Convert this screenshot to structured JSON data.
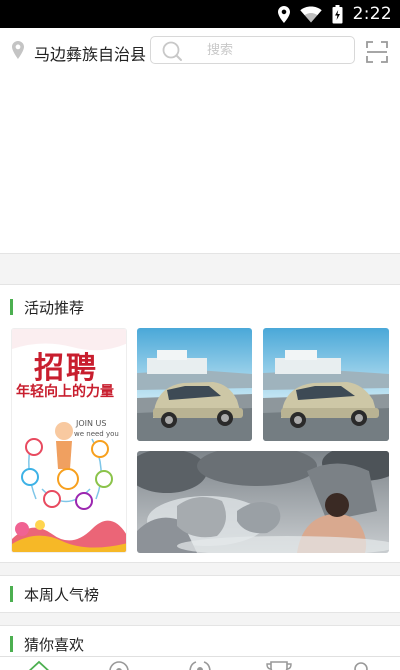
{
  "status_bar": {
    "time": "2:22",
    "icons": [
      "location-icon",
      "wifi-icon",
      "battery-icon"
    ]
  },
  "header": {
    "location": "马边彝族自治县",
    "search_placeholder": "搜索",
    "icons": [
      "location-pin-icon",
      "search-icon",
      "scan-icon"
    ]
  },
  "sections": {
    "activity": "活动推荐",
    "weekly_popular": "本周人气榜",
    "guess_you_like": "猜你喜欢"
  },
  "activity_tiles": {
    "recruit": {
      "headline": "招聘",
      "slogan": "年轻向上的力量",
      "join": "JOIN US",
      "need": "we need you"
    }
  },
  "bottom_nav": {
    "icons": [
      "home-icon",
      "discover-icon",
      "signal-icon",
      "trophy-icon",
      "profile-icon"
    ],
    "accent": "#4caf50"
  },
  "colors": {
    "accent": "#4caf50",
    "divider": "#e4e4e4",
    "status_bar": "#000000"
  }
}
